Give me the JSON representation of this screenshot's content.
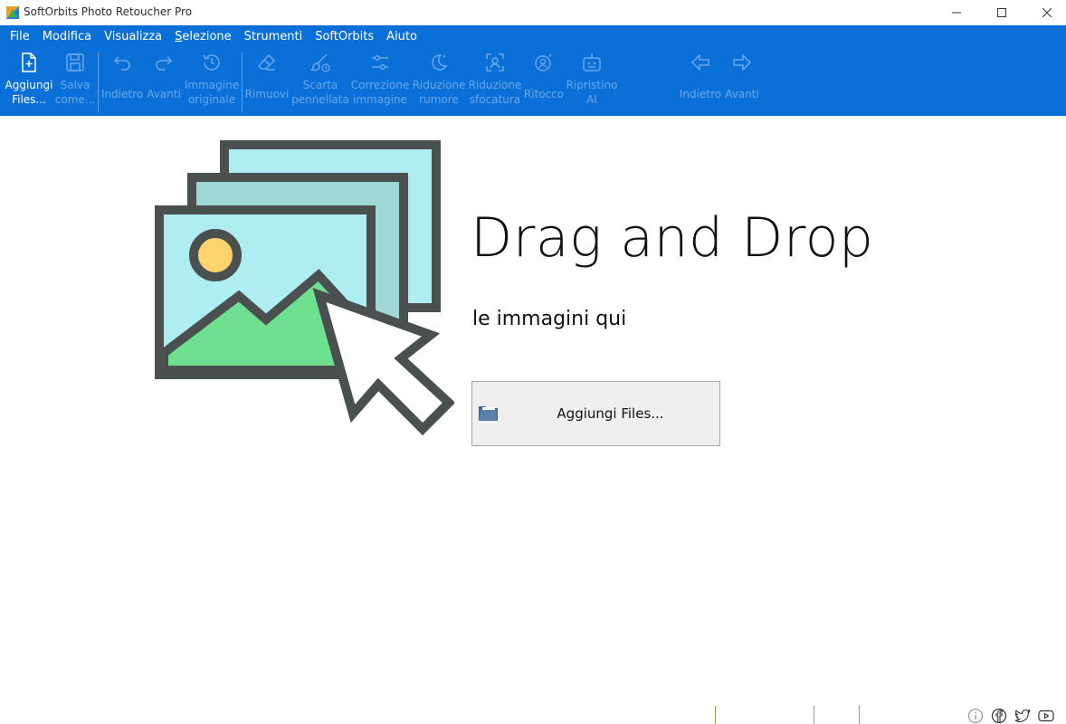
{
  "window": {
    "title": "SoftOrbits Photo Retoucher Pro"
  },
  "menu": [
    {
      "label": "File"
    },
    {
      "label": "Modifica"
    },
    {
      "label": "Visualizza"
    },
    {
      "label": "Selezione"
    },
    {
      "label": "Strumenti"
    },
    {
      "label": "SoftOrbits"
    },
    {
      "label": "Aiuto"
    }
  ],
  "toolbar": {
    "add_files": "Aggiungi\nFiles...",
    "save_as": "Salva\ncome...",
    "undo": "Indietro",
    "redo": "Avanti",
    "original_image": "Immagine\noriginale",
    "remove": "Rimuovi",
    "discard_stroke": "Scarta\npennellata",
    "image_correction": "Correzione\nimmagine",
    "noise_reduction": "Riduzione\nrumore",
    "blur_reduction": "Riduzione\nsfocatura",
    "retouch": "Ritocco",
    "ai_restore": "Ripristino\nAI",
    "nav_back": "Indietro",
    "nav_forward": "Avanti"
  },
  "main": {
    "headline": "Drag and Drop",
    "subline": "le immagini qui",
    "add_button": "Aggiungi Files..."
  },
  "colors": {
    "ribbon": "#0a6fd6",
    "art_outline": "#4a4f4f",
    "art_sky": "#aeeef0",
    "art_mountain": "#6fe08f",
    "art_sun": "#ffd36e"
  }
}
